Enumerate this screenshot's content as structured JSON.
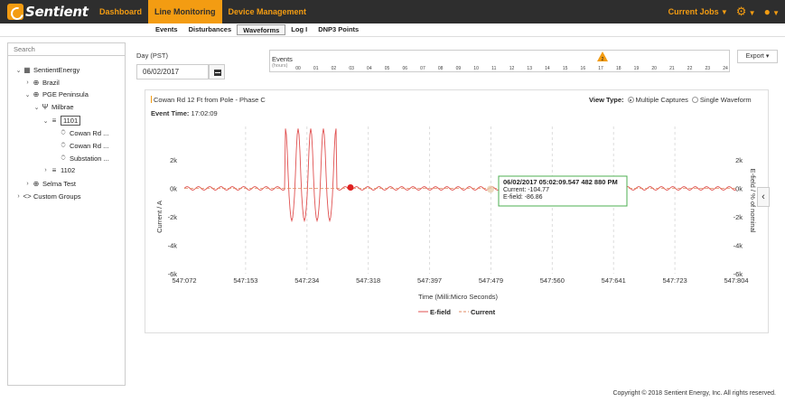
{
  "app": {
    "brand": "Sentient"
  },
  "nav": {
    "items": [
      {
        "label": "Dashboard",
        "active": false
      },
      {
        "label": "Line Monitoring",
        "active": true
      },
      {
        "label": "Device Management",
        "active": false
      }
    ],
    "current_jobs": "Current Jobs"
  },
  "subnav": {
    "items": [
      {
        "label": "Events",
        "active": false
      },
      {
        "label": "Disturbances",
        "active": false
      },
      {
        "label": "Waveforms",
        "active": true
      },
      {
        "label": "Log I",
        "active": false
      },
      {
        "label": "DNP3 Points",
        "active": false
      }
    ]
  },
  "sidebar": {
    "search_placeholder": "Search",
    "tree": [
      {
        "label": "SentientEnergy",
        "toggle": "⌄",
        "icon": "▦",
        "indent": 0
      },
      {
        "label": "Brazil",
        "toggle": "›",
        "icon": "⊕",
        "indent": 1
      },
      {
        "label": "PGE Peninsula",
        "toggle": "⌄",
        "icon": "⊕",
        "indent": 1
      },
      {
        "label": "Milbrae",
        "toggle": "⌄",
        "icon": "Ψ",
        "indent": 2
      },
      {
        "label": "1101",
        "toggle": "⌄",
        "icon": "≡",
        "indent": 3
      },
      {
        "label": "Cowan Rd ...",
        "toggle": "",
        "icon": "⍥",
        "indent": 4
      },
      {
        "label": "Cowan Rd ...",
        "toggle": "",
        "icon": "⍥",
        "indent": 4
      },
      {
        "label": "Substation ...",
        "toggle": "",
        "icon": "⍥",
        "indent": 4
      },
      {
        "label": "1102",
        "toggle": "›",
        "icon": "≡",
        "indent": 3
      },
      {
        "label": "Selma Test",
        "toggle": "›",
        "icon": "⊕",
        "indent": 1
      },
      {
        "label": "Custom Groups",
        "toggle": "›",
        "icon": "<>",
        "indent": 0
      }
    ]
  },
  "day": {
    "label": "Day (PST)",
    "value": "06/02/2017"
  },
  "events": {
    "title": "Events",
    "subtitle": "(hours)",
    "hours": [
      "00",
      "01",
      "02",
      "03",
      "04",
      "05",
      "06",
      "07",
      "08",
      "09",
      "10",
      "11",
      "12",
      "13",
      "14",
      "15",
      "16",
      "17",
      "18",
      "19",
      "20",
      "21",
      "22",
      "23",
      "24"
    ],
    "marker_count": "2",
    "marker_hour": 17
  },
  "export_label": "Export ▾",
  "panel": {
    "title": "Cowan Rd 12 Ft from Pole - Phase C",
    "event_time_label": "Event Time:",
    "event_time_value": "17:02:09",
    "view_type_label": "View Type:",
    "view_options": [
      {
        "label": "Multiple Captures",
        "selected": true
      },
      {
        "label": "Single Waveform",
        "selected": false
      }
    ]
  },
  "chart_data": {
    "type": "line",
    "xlabel": "Time (Milli:Micro Seconds)",
    "ylabel_left": "Current / A",
    "ylabel_right": "E-field / % of nominal",
    "x_ticks": [
      "547:072",
      "547:153",
      "547:234",
      "547:318",
      "547:397",
      "547:479",
      "547:560",
      "547:641",
      "547:723",
      "547:804"
    ],
    "y_ticks_left": [
      "2k",
      "0k",
      "-2k",
      "-4k",
      "-6k"
    ],
    "y_ticks_right": [
      "2k",
      "0k",
      "-2k",
      "-4k",
      "-6k"
    ],
    "ylim": [
      -6000,
      2000
    ],
    "grid_x": true,
    "series": [
      {
        "name": "E-field",
        "color": "#e05050",
        "style": "solid",
        "note_values": "steady 60Hz ripple near 0 with burst to +2k/-4k between 547:234 and 547:275"
      },
      {
        "name": "Current",
        "color": "#e08a60",
        "style": "dashed",
        "values_near": 0
      }
    ],
    "burst": {
      "start_x": "547:234",
      "cycles": 4,
      "peak": 1900,
      "trough": -4200
    },
    "ripple_amplitude": 120,
    "tooltip": {
      "timestamp": "06/02/2017 05:02:09.547 482 880 PM",
      "current": "Current: -104.77",
      "efield": "E-field: -86.86"
    },
    "legend": [
      "E-field",
      "Current"
    ]
  },
  "footer": {
    "copyright": "Copyright © 2018 Sentient Energy, Inc. All rights reserved."
  },
  "colors": {
    "accent": "#f39c12",
    "topbar": "#2e2e2e",
    "efield": "#e05050",
    "tooltip_border": "#4caf50"
  }
}
